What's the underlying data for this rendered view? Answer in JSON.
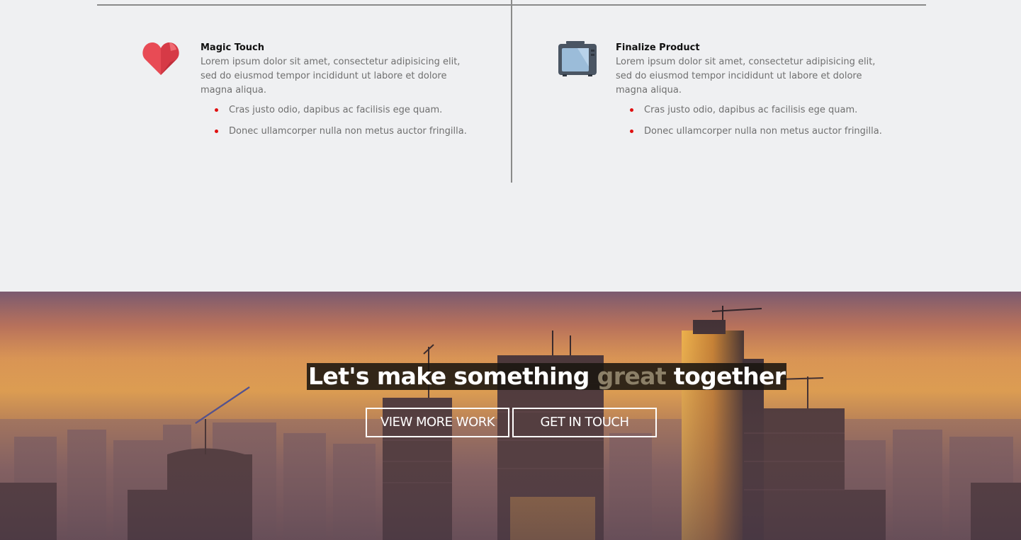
{
  "features": [
    {
      "icon": "heart-icon",
      "title": "Magic Touch",
      "text": "Lorem ipsum dolor sit amet, consectetur adipisicing elit, sed do eiusmod tempor incididunt ut labore et dolore magna aliqua.",
      "bullets": [
        "Cras justo odio, dapibus ac facilisis ege quam.",
        "Donec ullamcorper nulla non metus auctor fringilla."
      ]
    },
    {
      "icon": "tv-icon",
      "title": "Finalize Product",
      "text": "Lorem ipsum dolor sit amet, consectetur adipisicing elit, sed do eiusmod tempor incididunt ut labore et dolore magna aliqua.",
      "bullets": [
        "Cras justo odio, dapibus ac facilisis ege quam.",
        "Donec ullamcorper nulla non metus auctor fringilla."
      ]
    }
  ],
  "cta": {
    "title_start": "Let's make something ",
    "title_accent": "great",
    "title_end": " together",
    "buttons": {
      "view_more": "VIEW MORE WORK",
      "get_in_touch": "GET IN TOUCH"
    }
  },
  "colors": {
    "background": "#eff0f2",
    "bullet": "#e01010",
    "accent_text": "#8b7f67",
    "title_bg": "#1a1610"
  }
}
